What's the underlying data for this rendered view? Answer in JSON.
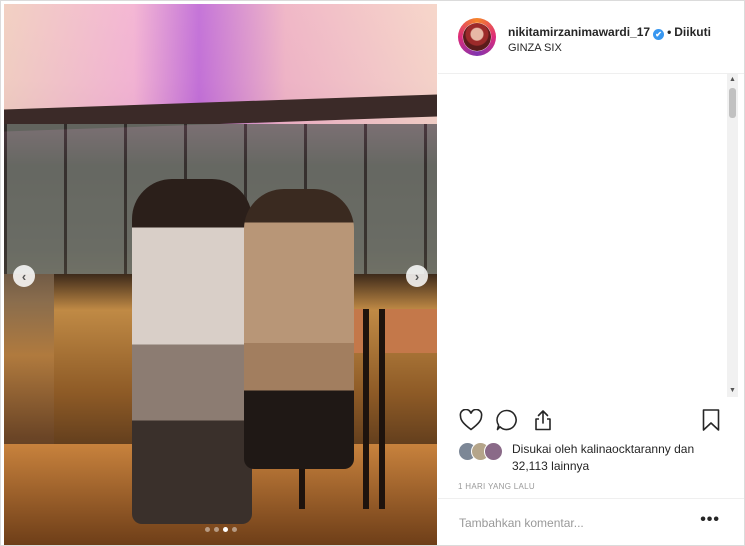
{
  "post": {
    "username": "nikitamirzanimawardi_17",
    "follow_status": "Diikuti",
    "separator": "•",
    "location": "GINZA SIX",
    "verified_icon": "✔"
  },
  "carousel": {
    "prev_icon": "chevron-left-icon",
    "next_icon": "chevron-right-icon",
    "prev_glyph": "‹",
    "next_glyph": "›",
    "slide_count": 4,
    "active_slide_index": 2
  },
  "scrollbar": {
    "up_glyph": "▲",
    "down_glyph": "▼"
  },
  "actions": {
    "like_icon": "heart-icon",
    "comment_icon": "comment-icon",
    "share_icon": "share-icon",
    "save_icon": "bookmark-icon"
  },
  "likes": {
    "text_prefix": "Disukai oleh ",
    "liker": "kalinaocktaranny",
    "text_connector": " dan",
    "count": "32,113",
    "count_suffix": " lainnya"
  },
  "timestamp": "1 HARI YANG LALU",
  "add_comment": {
    "placeholder": "Tambahkan komentar...",
    "more_glyph": "•••"
  },
  "colors": {
    "verified_blue": "#3897f0",
    "text": "#262626",
    "muted": "#999999",
    "border": "#dbdbdb"
  }
}
